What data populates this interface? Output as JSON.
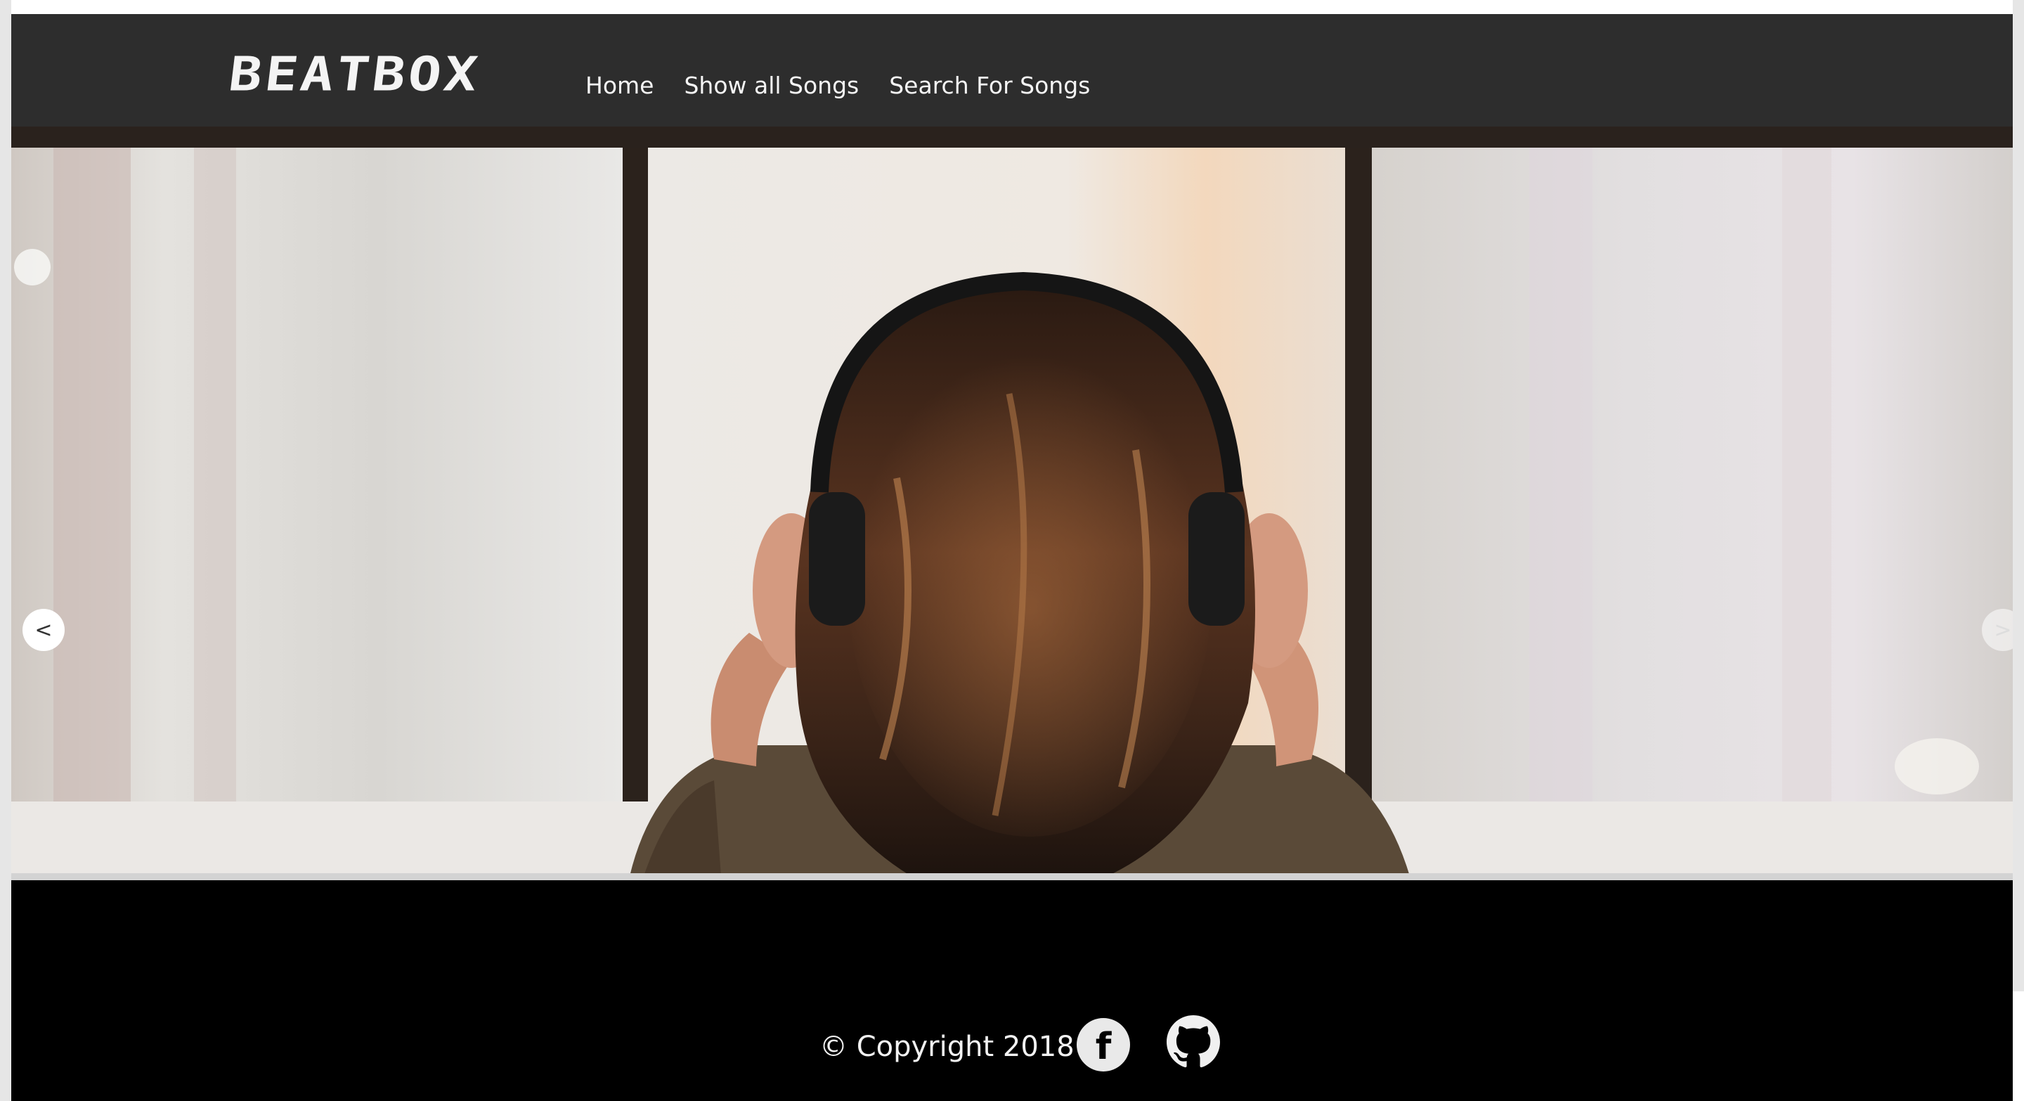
{
  "brand": {
    "logo_text": "BEATBOX"
  },
  "nav": {
    "items": [
      {
        "label": "Home"
      },
      {
        "label": "Show all Songs"
      },
      {
        "label": "Search For Songs"
      }
    ]
  },
  "carousel": {
    "prev_label": "<",
    "next_label": ">",
    "slide_image": "woman-with-headphones-at-window"
  },
  "footer": {
    "copyright": "© Copyright 2018",
    "social": [
      {
        "icon": "facebook-icon",
        "glyph": "f"
      },
      {
        "icon": "github-icon"
      }
    ]
  },
  "colors": {
    "navbar_bg": "#2d2d2d",
    "footer_bg": "#000000",
    "nav_text": "#f5f5f5"
  }
}
